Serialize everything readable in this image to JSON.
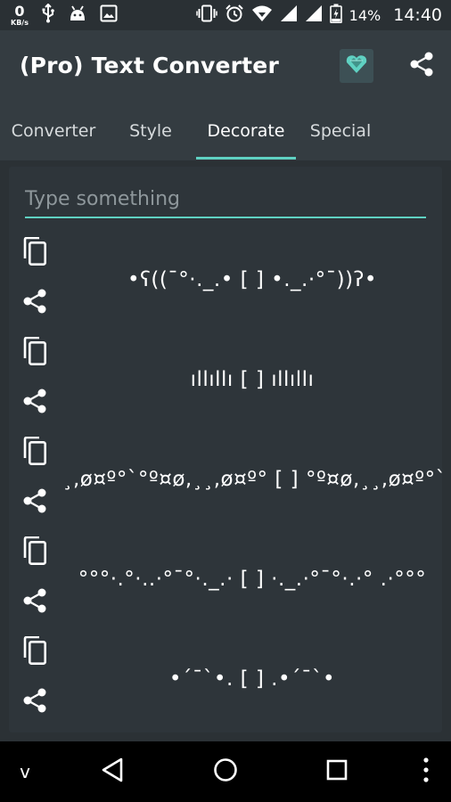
{
  "status_bar": {
    "net_speed_value": "0",
    "net_speed_unit": "KB/s",
    "battery_percent": "14%",
    "time": "14:40",
    "left_icons": [
      "usb-icon",
      "android-icon",
      "image-icon"
    ],
    "right_icons": [
      "vibrate-icon",
      "alarm-icon",
      "wifi-icon",
      "signal-icon",
      "signal-icon",
      "battery-charging-icon"
    ]
  },
  "app_bar": {
    "title": "(Pro) Text Converter",
    "pro_icon": "heart-gem-icon",
    "share_icon": "share-icon"
  },
  "tabs": {
    "items": [
      {
        "label": "Converter",
        "active": false
      },
      {
        "label": "Style",
        "active": false
      },
      {
        "label": "Decorate",
        "active": true
      },
      {
        "label": "Special",
        "active": false
      }
    ]
  },
  "input": {
    "placeholder": "Type something",
    "value": ""
  },
  "decorations": [
    "•ʕ((¯°·._.• [ ] •._.·°¯))ʔ•",
    "ıllıllı [ ] ıllıllı",
    "¸,ø¤º°`°º¤ø,¸¸,ø¤º° [ ] °º¤ø,¸¸,ø¤º°`°º¤ø,¸",
    "°°°·.°·..·°¯°·._.· [ ] ·._.·°¯°·.·° .·°°°",
    "•´¯`•. [ ] .•´¯`•"
  ],
  "nav_bar": {
    "icons": [
      "chevron-down-icon",
      "back-icon",
      "home-icon",
      "recents-icon",
      "more-vert-icon"
    ],
    "left_label": "v"
  },
  "colors": {
    "accent": "#5fd1c2",
    "app_bar": "#343c41",
    "background": "#2b3135",
    "card": "#2e353a"
  }
}
